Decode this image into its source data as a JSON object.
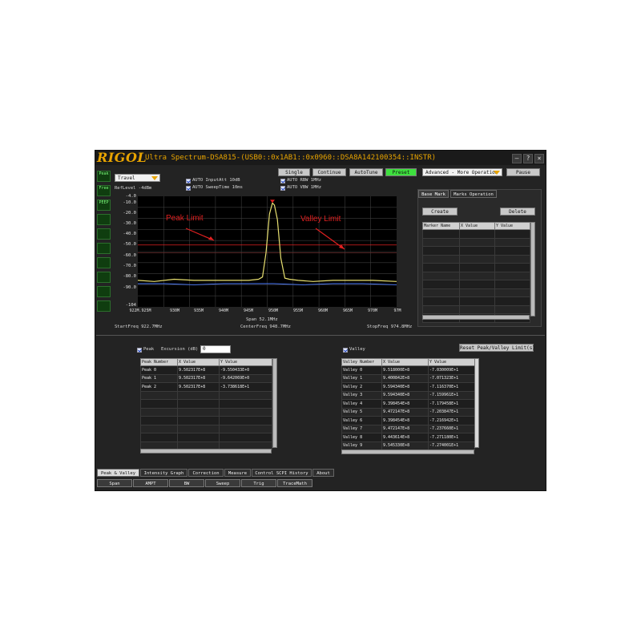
{
  "window": {
    "logo": "RIGOL",
    "title": "Ultra Spectrum-DSA815-(USB0::0x1AB1::0x0960::DSA8A142100354::INSTR)"
  },
  "toolbar": {
    "mode_select": "Travel",
    "single": "Single",
    "continue": "Continue",
    "autotune": "AutoTune",
    "preset": "Preset",
    "advanced_select": "Advanced - More Operation",
    "pause": "Pause"
  },
  "left_icons": [
    "Peak",
    "Free",
    "PEEP",
    "",
    "",
    "",
    "",
    "",
    "",
    "",
    ""
  ],
  "settings": {
    "reflevel": "RefLevel -4dBm",
    "input_att": "AUTO InputAtt 10dB",
    "sweep_time": "AUTO SweepTime 10ms",
    "rbw": "AUTO RBW 1MHz",
    "vbw": "AUTO VBW 1MHz"
  },
  "chart_data": {
    "type": "line",
    "title": "",
    "xlabel": "",
    "ylabel": "",
    "y_ticks": [
      "-4.0",
      "-10.0",
      "-20.0",
      "-30.0",
      "-40.0",
      "-50.0",
      "-60.0",
      "-70.0",
      "-80.0",
      "-90.0",
      "-104"
    ],
    "x_ticks": [
      "922M.925M",
      "930M",
      "935M",
      "940M",
      "945M",
      "950M",
      "955M",
      "960M",
      "965M",
      "970M",
      "97M"
    ],
    "ylim": [
      -104,
      -4
    ],
    "xlim": [
      922.7,
      974.8
    ],
    "grid": true,
    "series": [
      {
        "x": [
          922.7,
          926,
          930,
          934,
          938,
          942,
          945,
          947,
          947.8,
          948.5,
          949.2,
          949.8,
          950.2,
          950.8,
          951.5,
          952.3,
          953.2,
          955,
          958,
          962,
          966,
          970,
          974.8
        ],
        "values": [
          -80,
          -81,
          -79,
          -80,
          -80,
          -80,
          -80,
          -79,
          -77,
          -55,
          -20,
          -10,
          -12,
          -25,
          -60,
          -78,
          -79,
          -80,
          -81,
          -80,
          -80,
          -80,
          -81
        ],
        "color": "#e8e070"
      },
      {
        "x": [
          922.7,
          928,
          934,
          940,
          946,
          950,
          956,
          962,
          968,
          974.8
        ],
        "values": [
          -83,
          -83,
          -84,
          -83,
          -83,
          -83,
          -84,
          -83,
          -83,
          -84
        ],
        "color": "#4d7cff"
      }
    ],
    "peak_limit": -48,
    "valley_limit": -55,
    "annotations": [
      "Peak Limit",
      "Valley Limit"
    ],
    "span": "Span 52.1MHz",
    "start_freq": "StartFreq 922.7MHz",
    "center_freq": "CenterFreq 948.7MHz",
    "stop_freq": "StopFreq 974.8MHz"
  },
  "marks": {
    "tabs": [
      "Base Mark",
      "Marks Operation"
    ],
    "create": "Create",
    "delete": "Delete",
    "columns": [
      "Marker Name",
      "X Value",
      "Y Value"
    ]
  },
  "peak": {
    "label": "Peak",
    "excursion_label": "Excursion (dB)",
    "excursion_value": "0",
    "columns": [
      "Peak Number",
      "X Value",
      "Y Value"
    ],
    "rows": [
      [
        "Peak 0",
        "9.502317E+8",
        "-9.550433E+0"
      ],
      [
        "Peak 1",
        "9.502317E+8",
        "-9.642069E+0"
      ],
      [
        "Peak 2",
        "9.502317E+8",
        "-3.738618E+1"
      ]
    ]
  },
  "valley": {
    "label": "Valley",
    "reset": "Reset Peak/Valley Limit(s)",
    "columns": [
      "Valley Number",
      "X Value",
      "Y Value"
    ],
    "rows": [
      [
        "Valley 0",
        "9.518000E+8",
        "-7.030009E+1"
      ],
      [
        "Valley 1",
        "9.400842E+8",
        "-7.071323E+1"
      ],
      [
        "Valley 2",
        "9.594340E+8",
        "-7.116370E+1"
      ],
      [
        "Valley 3",
        "9.594340E+8",
        "-7.159961E+1"
      ],
      [
        "Valley 4",
        "9.398454E+8",
        "-7.179458E+1"
      ],
      [
        "Valley 5",
        "9.472147E+8",
        "-7.203847E+1"
      ],
      [
        "Valley 6",
        "9.398454E+8",
        "-7.216942E+1"
      ],
      [
        "Valley 7",
        "9.472147E+8",
        "-7.237660E+1"
      ],
      [
        "Valley 8",
        "9.443614E+8",
        "-7.271180E+1"
      ],
      [
        "Valley 9",
        "9.545330E+8",
        "-7.274001E+1"
      ]
    ]
  },
  "bottom_tabs": [
    "Peak & Valley",
    "Intensity Graph",
    "Correction",
    "Measure",
    "Control SCPI History",
    "About"
  ],
  "softkeys": [
    "Span",
    "AMPT",
    "BW",
    "Sweep",
    "Trig",
    "TraceMath"
  ],
  "colors": {
    "accent": "#e8a400",
    "trace": "#e8e070",
    "limit": "#e02020",
    "preset": "#3ee03e"
  }
}
